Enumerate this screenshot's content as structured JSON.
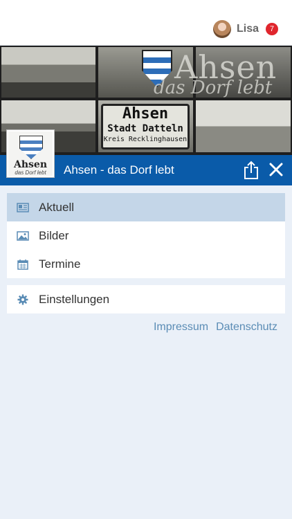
{
  "user": {
    "name": "Lisa",
    "notification_count": "7"
  },
  "hero": {
    "overlay_title": "Ahsen",
    "overlay_subtitle": "das Dorf lebt",
    "sign_line1": "Ahsen",
    "sign_line2": "Stadt Datteln",
    "sign_line3": "Kreis Recklinghausen"
  },
  "logo": {
    "title": "Ahsen",
    "subtitle": "das Dorf lebt"
  },
  "header": {
    "title": "Ahsen - das Dorf lebt"
  },
  "menu": {
    "items": [
      {
        "label": "Aktuell",
        "icon": "newspaper-icon",
        "active": true
      },
      {
        "label": "Bilder",
        "icon": "image-icon",
        "active": false
      },
      {
        "label": "Termine",
        "icon": "calendar-icon",
        "active": false
      }
    ],
    "settings": {
      "label": "Einstellungen",
      "icon": "gear-icon"
    }
  },
  "footer": {
    "impressum": "Impressum",
    "datenschutz": "Datenschutz"
  },
  "colors": {
    "primary": "#0a5ba9",
    "active_row": "#c4d6e8",
    "background": "#eaf0f8",
    "badge": "#e0262d",
    "link": "#5a8cb5"
  }
}
